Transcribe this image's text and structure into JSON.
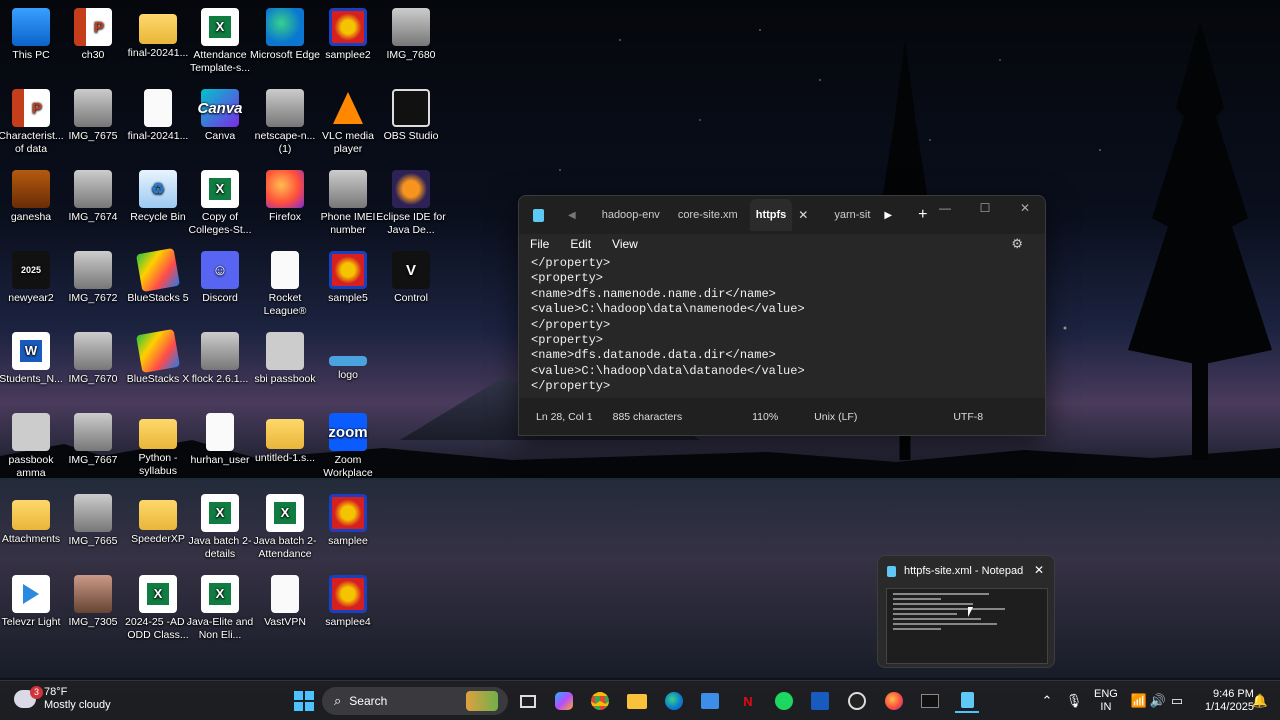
{
  "desktop": {
    "icons": [
      {
        "label": "This PC",
        "glyph": ""
      },
      {
        "label": "ch30",
        "glyph": "P"
      },
      {
        "label": "final-20241...",
        "glyph": ""
      },
      {
        "label": "Attendance Template-s...",
        "glyph": "X"
      },
      {
        "label": "Microsoft Edge",
        "glyph": ""
      },
      {
        "label": "samplee2",
        "glyph": ""
      },
      {
        "label": "IMG_7680",
        "glyph": ""
      },
      {
        "label": "Characterist... of data",
        "glyph": "P"
      },
      {
        "label": "IMG_7675",
        "glyph": ""
      },
      {
        "label": "final-20241...",
        "glyph": ""
      },
      {
        "label": "Canva",
        "glyph": "Canva"
      },
      {
        "label": "netscape-n... (1)",
        "glyph": ""
      },
      {
        "label": "VLC media player",
        "glyph": ""
      },
      {
        "label": "OBS Studio",
        "glyph": ""
      },
      {
        "label": "ganesha",
        "glyph": ""
      },
      {
        "label": "IMG_7674",
        "glyph": ""
      },
      {
        "label": "Recycle Bin",
        "glyph": "♻"
      },
      {
        "label": "Copy of Colleges-St...",
        "glyph": "X"
      },
      {
        "label": "Firefox",
        "glyph": ""
      },
      {
        "label": "Phone IMEI number",
        "glyph": ""
      },
      {
        "label": "Eclipse IDE for Java De...",
        "glyph": ""
      },
      {
        "label": "newyear2",
        "glyph": "2025"
      },
      {
        "label": "IMG_7672",
        "glyph": ""
      },
      {
        "label": "BlueStacks 5",
        "glyph": ""
      },
      {
        "label": "Discord",
        "glyph": "☺"
      },
      {
        "label": "Rocket League®",
        "glyph": ""
      },
      {
        "label": "sample5",
        "glyph": ""
      },
      {
        "label": "Control",
        "glyph": "V"
      },
      {
        "label": "Students_N...",
        "glyph": "W"
      },
      {
        "label": "IMG_7670",
        "glyph": ""
      },
      {
        "label": "BlueStacks X",
        "glyph": ""
      },
      {
        "label": "flock 2.6.1...",
        "glyph": ""
      },
      {
        "label": "sbi passbook",
        "glyph": ""
      },
      {
        "label": "logo",
        "glyph": ""
      },
      {
        "label": "passbook amma",
        "glyph": ""
      },
      {
        "label": "IMG_7667",
        "glyph": ""
      },
      {
        "label": "Python -syllabus",
        "glyph": ""
      },
      {
        "label": "hurhan_user",
        "glyph": ""
      },
      {
        "label": "untitled-1.s...",
        "glyph": ""
      },
      {
        "label": "Zoom Workplace",
        "glyph": "zoom"
      },
      {
        "label": "Attachments",
        "glyph": ""
      },
      {
        "label": "IMG_7665",
        "glyph": ""
      },
      {
        "label": "SpeederXP",
        "glyph": ""
      },
      {
        "label": "Java batch 2-details",
        "glyph": "X"
      },
      {
        "label": "Java batch 2-Attendance",
        "glyph": "X"
      },
      {
        "label": "samplee",
        "glyph": ""
      },
      {
        "label": "Televzr Light",
        "glyph": ""
      },
      {
        "label": "IMG_7305",
        "glyph": ""
      },
      {
        "label": "2024-25 -AD -ODD Class...",
        "glyph": "X"
      },
      {
        "label": "Java-Elite and Non Eli...",
        "glyph": "X"
      },
      {
        "label": "VastVPN",
        "glyph": ""
      },
      {
        "label": "samplee4",
        "glyph": ""
      }
    ]
  },
  "notepad": {
    "tabs": [
      "hadoop-env",
      "core-site.xm",
      "httpfs",
      "yarn-sit"
    ],
    "active_tab": "httpfs",
    "close_glyph": "✕",
    "plus_glyph": "+",
    "menu": {
      "file": "File",
      "edit": "Edit",
      "view": "View"
    },
    "lines": [
      "</property>",
      "<property>",
      "<name>dfs.namenode.name.dir</name>",
      "<value>C:\\hadoop\\data\\namenode</value>",
      "</property>",
      "<property>",
      "<name>dfs.datanode.data.dir</name>",
      "<value>C:\\hadoop\\data\\datanode</value>",
      "</property>"
    ],
    "status": {
      "position": "Ln 28, Col 1",
      "characters": "885 characters",
      "zoom": "110%",
      "line_ending": "Unix (LF)",
      "encoding": "UTF-8"
    }
  },
  "thumbnail": {
    "title": "httpfs-site.xml - Notepad",
    "close_glyph": "✕"
  },
  "taskbar": {
    "weather_temp": "78°F",
    "weather_desc": "Mostly cloudy",
    "weather_badge": "3",
    "search_placeholder": "Search",
    "lang_primary": "ENG",
    "lang_secondary": "IN",
    "time": "9:46 PM",
    "date": "1/14/2025"
  },
  "colors": {
    "accent": "#4cc2ff",
    "notepad_bg": "#272727",
    "excel": "#107c41",
    "word": "#185abd"
  }
}
